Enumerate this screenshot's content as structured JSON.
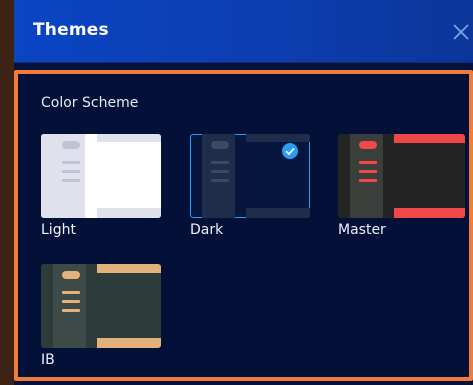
{
  "window": {
    "title": "Themes",
    "close_icon": "close-icon"
  },
  "colors": {
    "accent_border": "#f07b3a",
    "header_blue": "#0a45c4",
    "panel_bg": "#031139",
    "selected_outline": "#2a9df4"
  },
  "section": {
    "label": "Color Scheme"
  },
  "themes": [
    {
      "name": "Light",
      "selected": false
    },
    {
      "name": "Dark",
      "selected": true
    },
    {
      "name": "Master",
      "selected": false
    },
    {
      "name": "IB",
      "selected": false
    }
  ]
}
